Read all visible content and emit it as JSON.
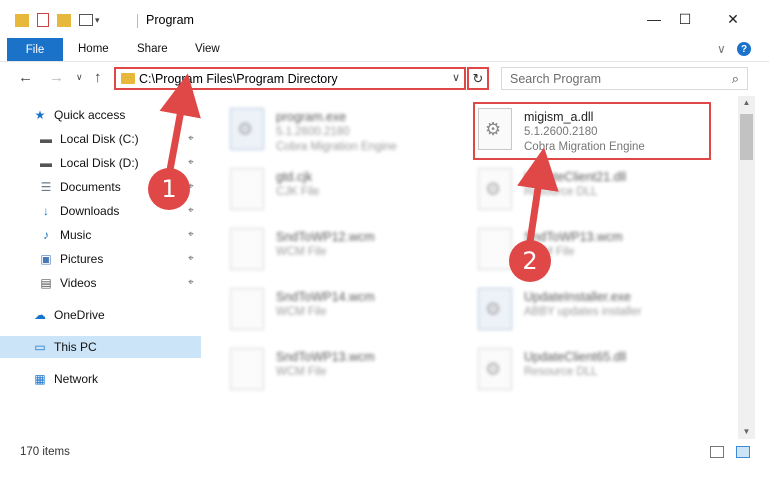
{
  "window": {
    "title": "Program",
    "minimize": "—",
    "maximize": "☐",
    "close": "✕"
  },
  "ribbon": {
    "file": "File",
    "tabs": [
      "Home",
      "Share",
      "View"
    ],
    "expand": "∨",
    "help": "?"
  },
  "nav": {
    "back": "←",
    "forward": "→",
    "recent": "∨",
    "up": "↑",
    "address": "C:\\Program Files\\Program Directory",
    "address_dropdown": "∨",
    "refresh": "↻",
    "search_placeholder": "Search Program",
    "search_icon": "⌕"
  },
  "sidebar": {
    "items": [
      {
        "label": "Quick access",
        "icon": "star-icon",
        "glyph": "★",
        "color": "#1a73c9"
      },
      {
        "label": "Local Disk (C:)",
        "icon": "drive-icon",
        "glyph": "▬",
        "color": "#555"
      },
      {
        "label": "Local Disk (D:)",
        "icon": "drive-icon",
        "glyph": "▬",
        "color": "#555"
      },
      {
        "label": "Documents",
        "icon": "documents-icon",
        "glyph": "☰",
        "color": "#6b7b8c"
      },
      {
        "label": "Downloads",
        "icon": "downloads-icon",
        "glyph": "↓",
        "color": "#1a73c9"
      },
      {
        "label": "Music",
        "icon": "music-icon",
        "glyph": "♪",
        "color": "#1a73c9"
      },
      {
        "label": "Pictures",
        "icon": "pictures-icon",
        "glyph": "▣",
        "color": "#4a7ab5"
      },
      {
        "label": "Videos",
        "icon": "videos-icon",
        "glyph": "▤",
        "color": "#555"
      },
      {
        "label": "OneDrive",
        "icon": "cloud-icon",
        "glyph": "☁",
        "color": "#1a73c9"
      },
      {
        "label": "This PC",
        "icon": "computer-icon",
        "glyph": "▭",
        "color": "#1a73c9"
      },
      {
        "label": "Network",
        "icon": "network-icon",
        "glyph": "▦",
        "color": "#1a73c9"
      }
    ],
    "pin_glyph": "⌖"
  },
  "files": [
    {
      "name": "program.exe",
      "type": "5.1.2600.2180",
      "desc": "Cobra Migration Engine"
    },
    {
      "name": "migism_a.dll",
      "type": "5.1.2600.2180",
      "desc": "Cobra Migration Engine"
    },
    {
      "name": "gtd.cjk",
      "type": "CJK File",
      "desc": ""
    },
    {
      "name": "UpdateClient21.dll",
      "type": "Resource DLL",
      "desc": ""
    },
    {
      "name": "SndToWP12.wcm",
      "type": "WCM File",
      "desc": ""
    },
    {
      "name": "SndToWP13.wcm",
      "type": "WCM File",
      "desc": ""
    },
    {
      "name": "SndToWP14.wcm",
      "type": "WCM File",
      "desc": ""
    },
    {
      "name": "UpdateInstaller.exe",
      "type": "ABBY updates installer",
      "desc": ""
    },
    {
      "name": "SndToWP13.wcm",
      "type": "WCM File",
      "desc": ""
    },
    {
      "name": "UpdateClient65.dll",
      "type": "Resource DLL",
      "desc": ""
    }
  ],
  "status": {
    "count": "170 items"
  },
  "annotations": {
    "step1": "1",
    "step2": "2",
    "color": "#e04848"
  }
}
